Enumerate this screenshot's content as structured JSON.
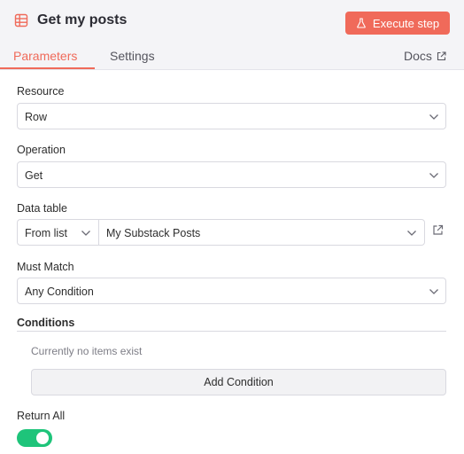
{
  "header": {
    "title": "Get my posts",
    "title_icon": "table-icon",
    "execute_label": "Execute step",
    "accent_color": "#f06a5a"
  },
  "tabs": [
    {
      "label": "Parameters",
      "active": true
    },
    {
      "label": "Settings",
      "active": false
    }
  ],
  "docs_label": "Docs",
  "fields": {
    "resource": {
      "label": "Resource",
      "value": "Row"
    },
    "operation": {
      "label": "Operation",
      "value": "Get"
    },
    "data_table": {
      "label": "Data table",
      "mode": "From list",
      "value": "My Substack Posts"
    },
    "must_match": {
      "label": "Must Match",
      "value": "Any Condition"
    }
  },
  "conditions": {
    "title": "Conditions",
    "empty_text": "Currently no items exist",
    "add_label": "Add Condition"
  },
  "return_all": {
    "label": "Return All",
    "enabled": true,
    "color": "#1ec47a"
  }
}
